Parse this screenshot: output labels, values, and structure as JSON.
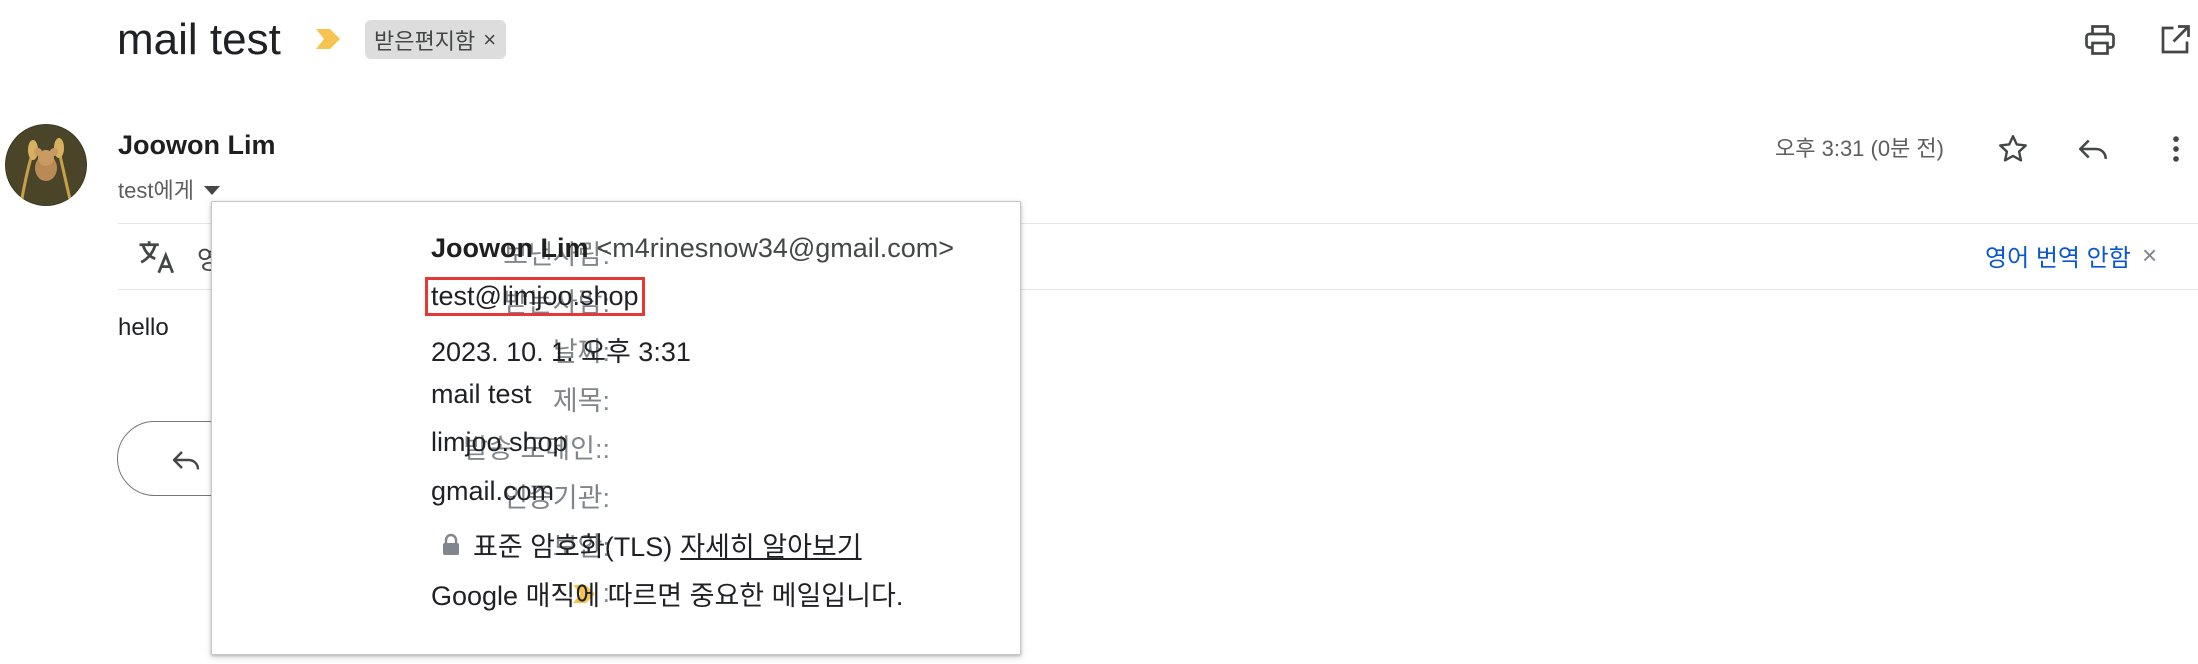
{
  "header": {
    "subject": "mail test",
    "label": "받은편지함",
    "label_close": "×"
  },
  "sender": {
    "name": "Joowon Lim",
    "to_line": "test에게",
    "date": "오후 3:31 (0분 전)"
  },
  "translate_bar": {
    "partial_text": "영",
    "off_link": "영어 번역 안함",
    "close": "×"
  },
  "message": {
    "body": "hello"
  },
  "details": {
    "from_label": "보낸사람:",
    "from_name": "Joowon Lim",
    "from_email": "<m4rinesnow34@gmail.com>",
    "to_label": "받는사람:",
    "to_value": "test@limjoo.shop",
    "date_label": "날짜:",
    "date_value": "2023. 10. 1. 오후 3:31",
    "subject_label": "제목:",
    "subject_value": "mail test",
    "mailed_by_label": "발송 도메인::",
    "mailed_by_value": "limjoo.shop",
    "signed_by_label": "인증기관:",
    "signed_by_value": "gmail.com",
    "security_label": "보안:",
    "security_value": "표준 암호화(TLS)",
    "security_link": "자세히 알아보기",
    "importance_label": ":",
    "importance_value": "Google 매직에 따르면 중요한 메일입니다."
  },
  "colors": {
    "importance_marker": "#f5c451",
    "link": "#0b57d0",
    "highlight_box": "#e53935"
  },
  "icons": [
    "importance-marker-icon",
    "print-icon",
    "open-in-new-window-icon",
    "star-icon",
    "reply-icon",
    "more-vert-icon",
    "translate-icon",
    "lock-icon",
    "dropdown-caret-icon"
  ]
}
